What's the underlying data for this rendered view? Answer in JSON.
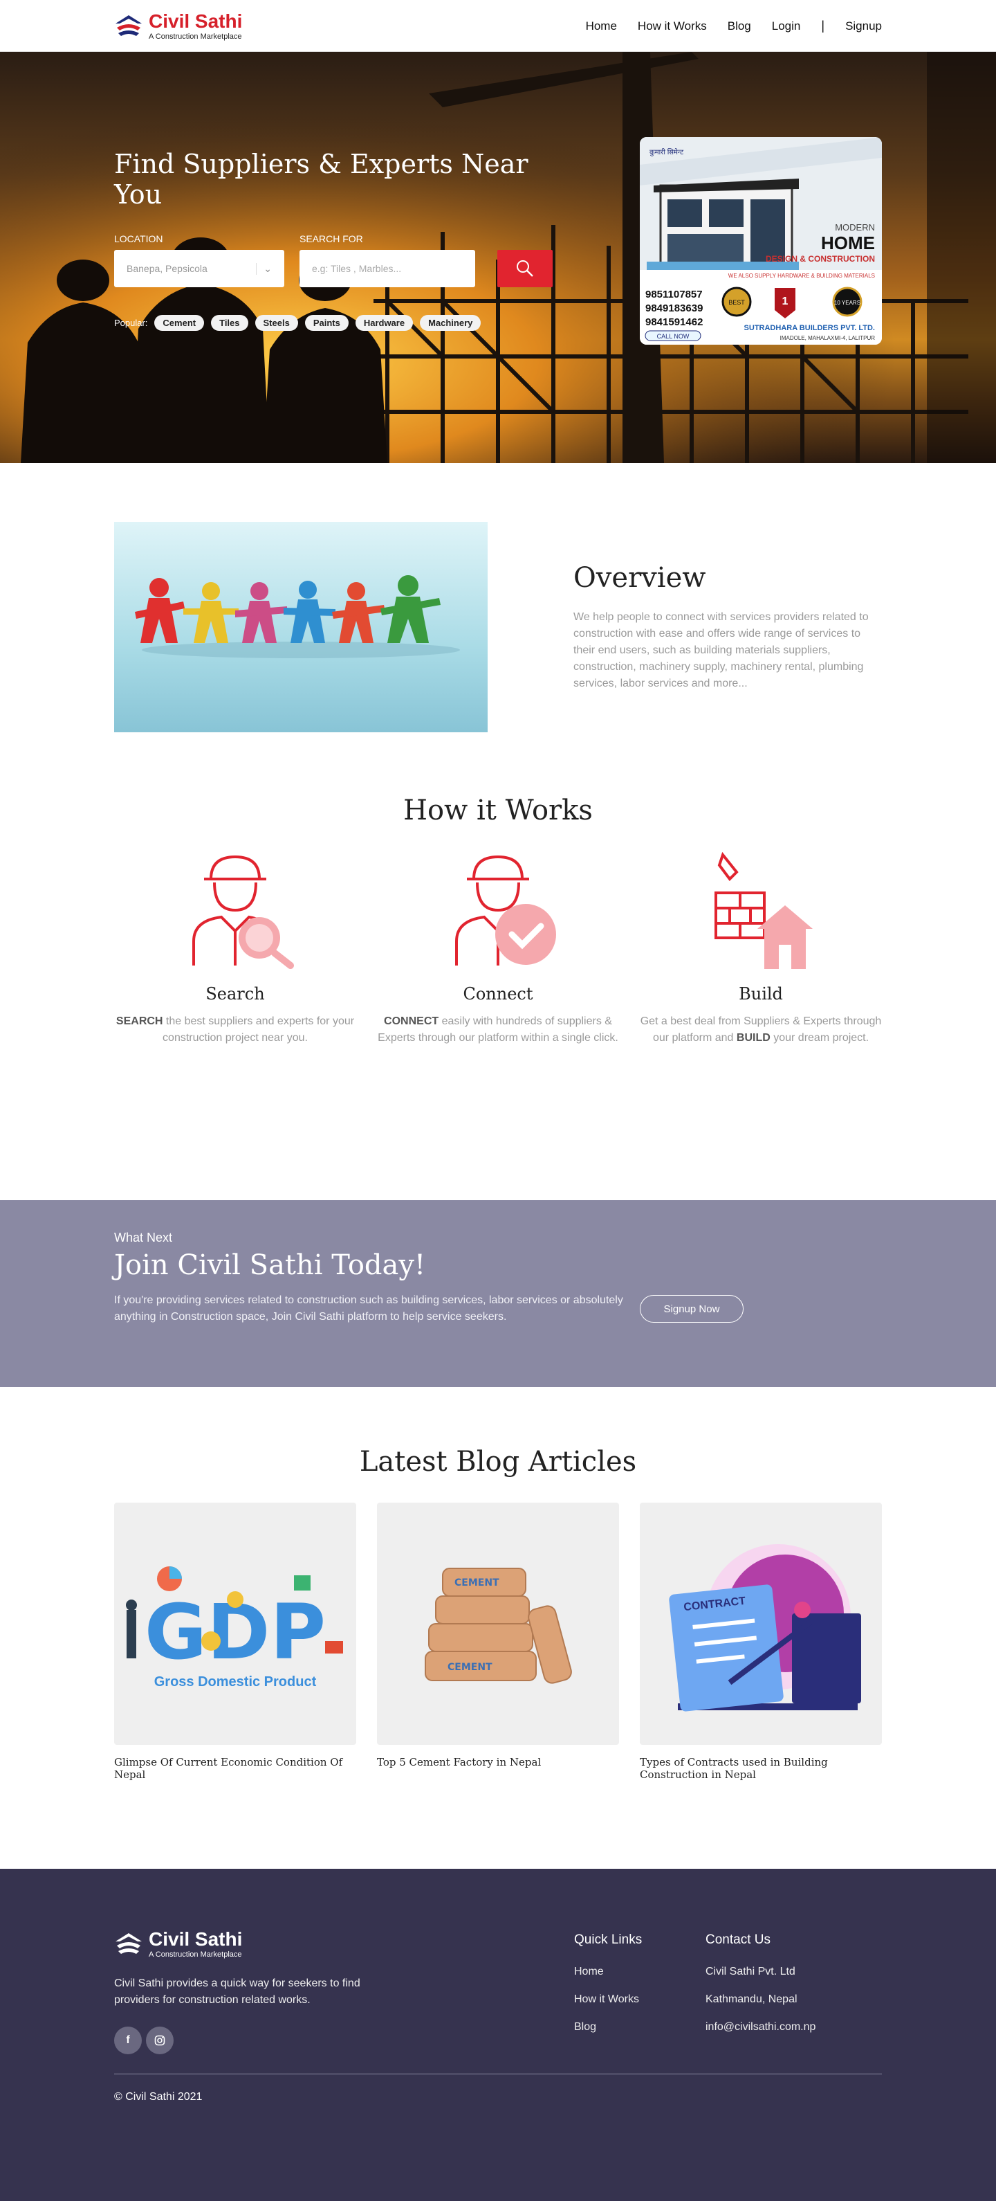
{
  "brand": {
    "name": "Civil Sathi",
    "tagline": "A Construction Marketplace",
    "color": "#d6202a"
  },
  "nav": {
    "home": "Home",
    "how": "How it Works",
    "blog": "Blog",
    "login": "Login",
    "sep": "|",
    "signup": "Signup"
  },
  "hero": {
    "title": "Find Suppliers & Experts Near You",
    "location_label": "LOCATION",
    "location_value": "Banepa, Pepsicola",
    "search_label": "SEARCH FOR",
    "search_placeholder": "e.g: Tiles , Marbles...",
    "popular_label": "Popular:",
    "popular": [
      "Cement",
      "Tiles",
      "Steels",
      "Paints",
      "Hardware",
      "Machinery"
    ]
  },
  "ad": {
    "brand_small": "कुमारी सिमेन्ट",
    "line1": "MODERN",
    "line2": "HOME",
    "line3": "DESIGN & CONSTRUCTION",
    "line4": "WE ALSO SUPPLY HARDWARE & BUILDING MATERIALS",
    "phones": [
      "9851107857",
      "9849183639",
      "9841591462"
    ],
    "call": "CALL NOW",
    "company": "SUTRADHARA BUILDERS PVT. LTD.",
    "address": "IMADOLE, MAHALAXMI-4, LALITPUR",
    "badges": [
      "BEST",
      "1",
      "10 YEARS"
    ]
  },
  "overview": {
    "title": "Overview",
    "text": "We help people to connect with services providers related to construction with ease and offers wide range of services to their end users, such as building materials suppliers, construction, machinery supply, machinery rental, plumbing services, labor services and more..."
  },
  "how": {
    "title": "How it Works",
    "steps": [
      {
        "title": "Search",
        "bold": "SEARCH",
        "text": " the best suppliers and experts for your construction project near you."
      },
      {
        "title": "Connect",
        "bold": "CONNECT",
        "text": " easily with hundreds of suppliers & Experts through our platform within a single click."
      },
      {
        "title": "Build",
        "pre": "Get a best deal from Suppliers & Experts through our platform and ",
        "bold": "BUILD",
        "text": " your dream project."
      }
    ]
  },
  "join": {
    "small": "What Next",
    "title": "Join Civil Sathi Today!",
    "text": "If you're providing services related to construction such as building services, labor services or absolutely anything in Construction space, Join Civil Sathi platform to help service seekers.",
    "button": "Signup Now"
  },
  "blog": {
    "title": "Latest Blog Articles",
    "posts": [
      {
        "title": "Glimpse Of Current Economic Condition Of Nepal",
        "img_text": "Gross Domestic Product",
        "img_big": "GDP"
      },
      {
        "title": "Top 5 Cement Factory in Nepal",
        "img_text": "CEMENT"
      },
      {
        "title": "Types of Contracts used in Building Construction in Nepal",
        "img_text": "CONTRACT"
      }
    ]
  },
  "footer": {
    "about": "Civil Sathi provides a quick way for seekers to find providers for construction related works.",
    "social": [
      "facebook-icon",
      "instagram-icon"
    ],
    "quick_title": "Quick Links",
    "quick": [
      "Home",
      "How it Works",
      "Blog"
    ],
    "contact_title": "Contact Us",
    "contact": [
      "Civil Sathi Pvt. Ltd",
      "Kathmandu, Nepal",
      "info@civilsathi.com.np"
    ],
    "copyright": "© Civil Sathi 2021"
  },
  "colors": {
    "accent": "#e1242f",
    "join_bg": "#8a89a3",
    "footer_bg": "#36334f"
  }
}
